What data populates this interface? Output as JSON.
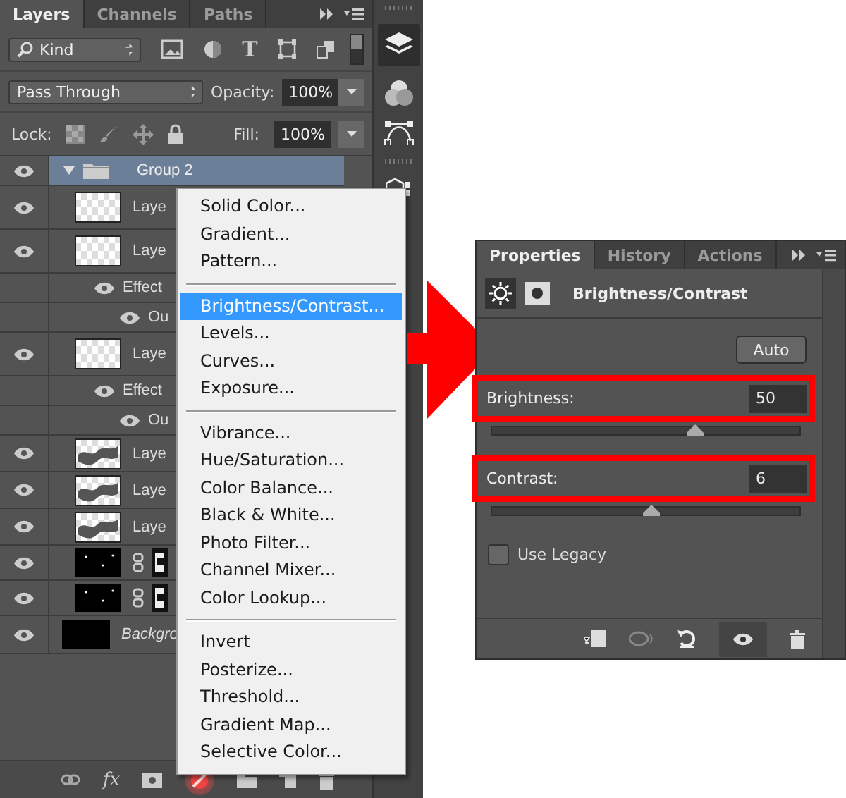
{
  "layers_panel": {
    "tabs": [
      {
        "label": "Layers",
        "selected": true
      },
      {
        "label": "Channels",
        "selected": false
      },
      {
        "label": "Paths",
        "selected": false
      }
    ],
    "filter": {
      "value": "Kind",
      "type_glyph": "T"
    },
    "effects_glyph": "fx",
    "blend_mode": {
      "value": "Pass Through"
    },
    "opacity": {
      "label": "Opacity:",
      "value": "100%"
    },
    "lock": {
      "label": "Lock:"
    },
    "fill": {
      "label": "Fill:",
      "value": "100%"
    },
    "layers": [
      {
        "kind": "group",
        "name": "Group 2",
        "visible": true,
        "expanded": true,
        "selected": true
      },
      {
        "kind": "layer",
        "name": "Laye",
        "visible": true,
        "selected": false
      },
      {
        "kind": "layer",
        "name": "Laye",
        "visible": true,
        "selected": false
      },
      {
        "kind": "effects",
        "name": "Effect",
        "visible": true
      },
      {
        "kind": "effect",
        "name": "Ou",
        "visible": true
      },
      {
        "kind": "layer",
        "name": "Laye",
        "visible": true,
        "selected": false
      },
      {
        "kind": "effects",
        "name": "Effect",
        "visible": true
      },
      {
        "kind": "effect",
        "name": "Ou",
        "visible": true
      },
      {
        "kind": "texture",
        "name": "Laye",
        "visible": true,
        "selected": false
      },
      {
        "kind": "texture",
        "name": "Laye",
        "visible": true,
        "selected": false
      },
      {
        "kind": "texture",
        "name": "Laye",
        "visible": true,
        "selected": false
      },
      {
        "kind": "masked",
        "visible": true,
        "selected": false
      },
      {
        "kind": "masked",
        "visible": true,
        "selected": false
      },
      {
        "kind": "background",
        "name": "Backgro",
        "visible": true,
        "selected": false
      }
    ]
  },
  "adjustment_menu": {
    "sections": [
      [
        {
          "label": "Solid Color...",
          "selected": false
        },
        {
          "label": "Gradient...",
          "selected": false
        },
        {
          "label": "Pattern...",
          "selected": false
        }
      ],
      [
        {
          "label": "Brightness/Contrast...",
          "selected": true
        },
        {
          "label": "Levels...",
          "selected": false
        },
        {
          "label": "Curves...",
          "selected": false
        },
        {
          "label": "Exposure...",
          "selected": false
        }
      ],
      [
        {
          "label": "Vibrance...",
          "selected": false
        },
        {
          "label": "Hue/Saturation...",
          "selected": false
        },
        {
          "label": "Color Balance...",
          "selected": false
        },
        {
          "label": "Black & White...",
          "selected": false
        },
        {
          "label": "Photo Filter...",
          "selected": false
        },
        {
          "label": "Channel Mixer...",
          "selected": false
        },
        {
          "label": "Color Lookup...",
          "selected": false
        }
      ],
      [
        {
          "label": "Invert",
          "selected": false
        },
        {
          "label": "Posterize...",
          "selected": false
        },
        {
          "label": "Threshold...",
          "selected": false
        },
        {
          "label": "Gradient Map...",
          "selected": false
        },
        {
          "label": "Selective Color...",
          "selected": false
        }
      ]
    ]
  },
  "properties_panel": {
    "tabs": [
      {
        "label": "Properties",
        "selected": true
      },
      {
        "label": "History",
        "selected": false
      },
      {
        "label": "Actions",
        "selected": false
      }
    ],
    "title": "Brightness/Contrast",
    "auto_button": "Auto",
    "sliders": [
      {
        "label": "Brightness:",
        "value": "50",
        "level": 0.66,
        "highlighted": true
      },
      {
        "label": "Contrast:",
        "value": "6",
        "level": 0.52,
        "highlighted": true
      }
    ],
    "use_legacy": {
      "label": "Use Legacy",
      "checked": false
    }
  }
}
